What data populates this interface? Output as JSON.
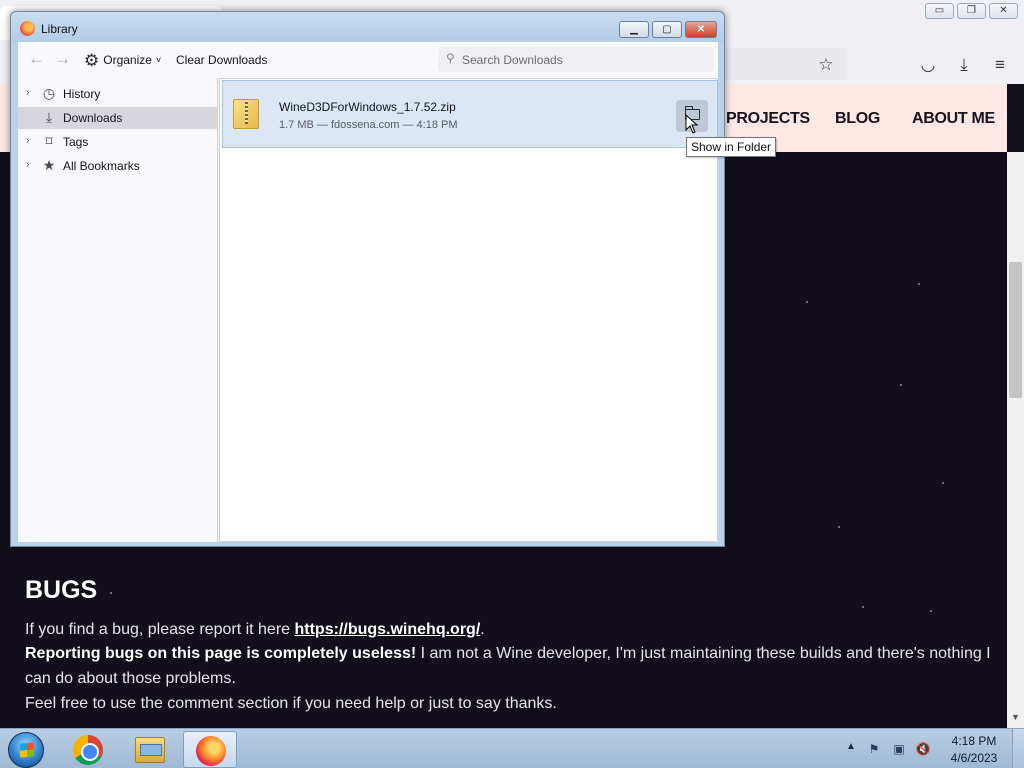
{
  "browser": {
    "site_nav": [
      "PROJECTS",
      "BLOG",
      "ABOUT ME"
    ],
    "win_controls": {
      "minimize": "▭",
      "restore": "❐",
      "close": "✕"
    },
    "toolbar_icons": [
      "bookmark-star-icon",
      "pocket-icon",
      "downloads-icon",
      "menu-icon"
    ]
  },
  "page": {
    "heading": "BUGS",
    "line1_pre": "If you find a bug, please report it here ",
    "line1_link": "https://bugs.winehq.org/",
    "line1_post": ".",
    "line2_bold": "Reporting bugs on this page is completely useless!",
    "line2_rest": " I am not a Wine developer, I'm just maintaining these builds and there's nothing I",
    "line3": "can do about those problems.",
    "line4": "Feel free to use the comment section if you need help or just to say thanks."
  },
  "library": {
    "title": "Library",
    "controls": {
      "minimize": "▁",
      "maximize": "▢",
      "close": "✕"
    },
    "toolbar": {
      "back_icon": "←",
      "forward_icon": "→",
      "organize_label": "Organize",
      "organize_chevron": "˅",
      "clear_label": "Clear Downloads",
      "search_placeholder": "Search Downloads"
    },
    "sidebar": [
      {
        "label": "History",
        "icon": "clock-icon",
        "glyph": "◷",
        "twisty": "›",
        "selected": false
      },
      {
        "label": "Downloads",
        "icon": "download-icon",
        "glyph": "⤓",
        "twisty": "",
        "selected": true
      },
      {
        "label": "Tags",
        "icon": "tag-icon",
        "glyph": "⌑",
        "twisty": "›",
        "selected": false
      },
      {
        "label": "All Bookmarks",
        "icon": "star-icon",
        "glyph": "★",
        "twisty": "›",
        "selected": false
      }
    ],
    "downloads": [
      {
        "filename": "WineD3DForWindows_1.7.52.zip",
        "meta": "1.7 MB — fdossena.com — 4:18 PM"
      }
    ],
    "tooltip": "Show in Folder"
  },
  "taskbar": {
    "apps": [
      {
        "name": "chrome",
        "active": false
      },
      {
        "name": "explorer",
        "active": false
      },
      {
        "name": "firefox",
        "active": true
      }
    ],
    "tray_arrow": "▲",
    "clock_time": "4:18 PM",
    "clock_date": "4/6/2023"
  }
}
